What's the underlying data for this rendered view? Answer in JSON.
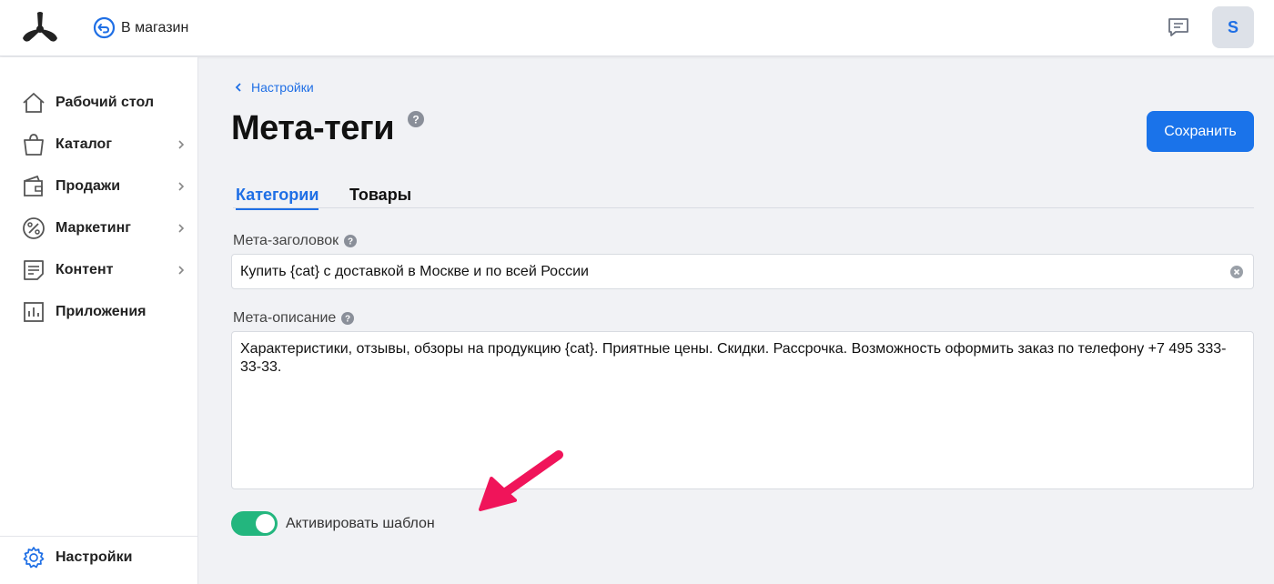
{
  "header": {
    "store_link": "В магазин",
    "avatar_initial": "S"
  },
  "sidebar": {
    "items": [
      {
        "label": "Рабочий стол",
        "icon": "home-icon",
        "has_chevron": false
      },
      {
        "label": "Каталог",
        "icon": "bag-icon",
        "has_chevron": true
      },
      {
        "label": "Продажи",
        "icon": "wallet-icon",
        "has_chevron": true
      },
      {
        "label": "Маркетинг",
        "icon": "percent-icon",
        "has_chevron": true
      },
      {
        "label": "Контент",
        "icon": "document-icon",
        "has_chevron": true
      },
      {
        "label": "Приложения",
        "icon": "chart-icon",
        "has_chevron": false
      }
    ],
    "settings": {
      "label": "Настройки",
      "icon": "gear-icon"
    }
  },
  "main": {
    "breadcrumb": "Настройки",
    "title": "Мета-теги",
    "save_label": "Сохранить",
    "tabs": [
      {
        "label": "Категории",
        "active": true
      },
      {
        "label": "Товары",
        "active": false
      }
    ],
    "meta_title": {
      "label": "Мета-заголовок",
      "value": "Купить {cat} с доставкой в Москве и по всей России"
    },
    "meta_description": {
      "label": "Мета-описание",
      "value": "Характеристики, отзывы, обзоры на продукцию {cat}. Приятные цены. Скидки. Рассрочка. Возможность оформить заказ по телефону +7 495 333-33-33."
    },
    "template_toggle": {
      "label": "Активировать шаблон",
      "enabled": true
    }
  },
  "colors": {
    "accent": "#1f6fe5",
    "toggle_on": "#23b67e",
    "annotation_arrow": "#f0145a"
  }
}
